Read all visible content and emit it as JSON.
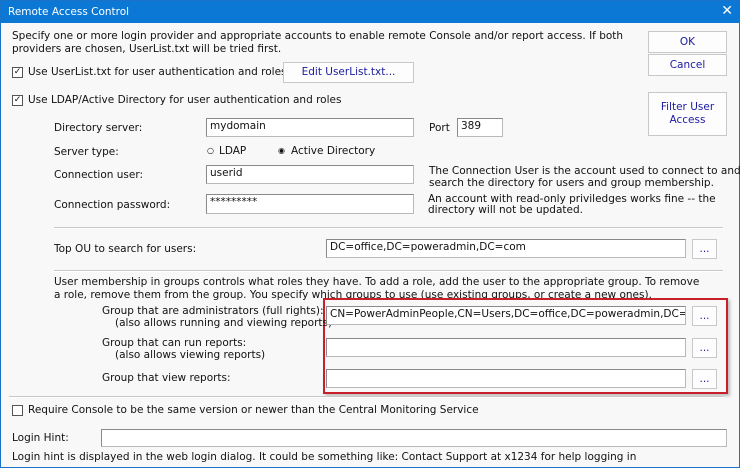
{
  "window": {
    "title": "Remote Access Control",
    "close_icon": "close-icon"
  },
  "intro": [
    "Specify one or more login provider and appropriate accounts to enable remote Console and/or report access.  If both",
    "providers are chosen, UserList.txt will be tried first."
  ],
  "buttons": {
    "ok": "OK",
    "cancel": "Cancel",
    "filter": "Filter User Access",
    "edit_userlist": "Edit UserList.txt...",
    "browse": "..."
  },
  "use_userlist": {
    "label": "Use UserList.txt for user authentication and roles",
    "checked": true
  },
  "use_ldap": {
    "label": "Use LDAP/Active Directory for user authentication and roles",
    "checked": true
  },
  "directory_server": {
    "label": "Directory server:",
    "value": "mydomain"
  },
  "port": {
    "label": "Port",
    "value": "389"
  },
  "server_type": {
    "label": "Server type:",
    "options": [
      "LDAP",
      "Active Directory"
    ],
    "selected": "Active Directory"
  },
  "connection_user": {
    "label": "Connection user:",
    "value": "userid",
    "help": [
      "The Connection User is the account used to connect to and",
      "search the directory for users and group membership."
    ]
  },
  "connection_password": {
    "label": "Connection password:",
    "value": "*********",
    "help": [
      "An account with read-only priviledges works fine -- the",
      "directory will not be updated."
    ]
  },
  "top_ou": {
    "label": "Top OU to search for users:",
    "value": "DC=office,DC=poweradmin,DC=com"
  },
  "membership_text": [
    "User membership in groups controls what roles they have. To add a role, add the user to the appropriate group. To remove",
    "a role, remove them from the group.  You specify which groups to use (use existing groups, or create a new ones)."
  ],
  "groups": [
    {
      "label": "Group that are administrators (full rights):",
      "sub": "(also allows running and viewing reports)",
      "value": "CN=PowerAdminPeople,CN=Users,DC=office,DC=poweradmin,DC=com"
    },
    {
      "label": "Group that can run reports:",
      "sub": "(also allows viewing reports)",
      "value": ""
    },
    {
      "label": "Group that view reports:",
      "sub": "",
      "value": ""
    }
  ],
  "require_console": {
    "label": "Require Console to be the same version or newer than the Central Monitoring Service",
    "checked": false
  },
  "login_hint": {
    "label": "Login Hint:",
    "value": "",
    "help": "Login hint is displayed in the web login dialog.  It could be something like: Contact Support at x1234 for help logging in"
  },
  "colors": {
    "titlebar": "#0a78d4",
    "highlight": "#c8202a",
    "button_text": "#1a1aa0"
  }
}
